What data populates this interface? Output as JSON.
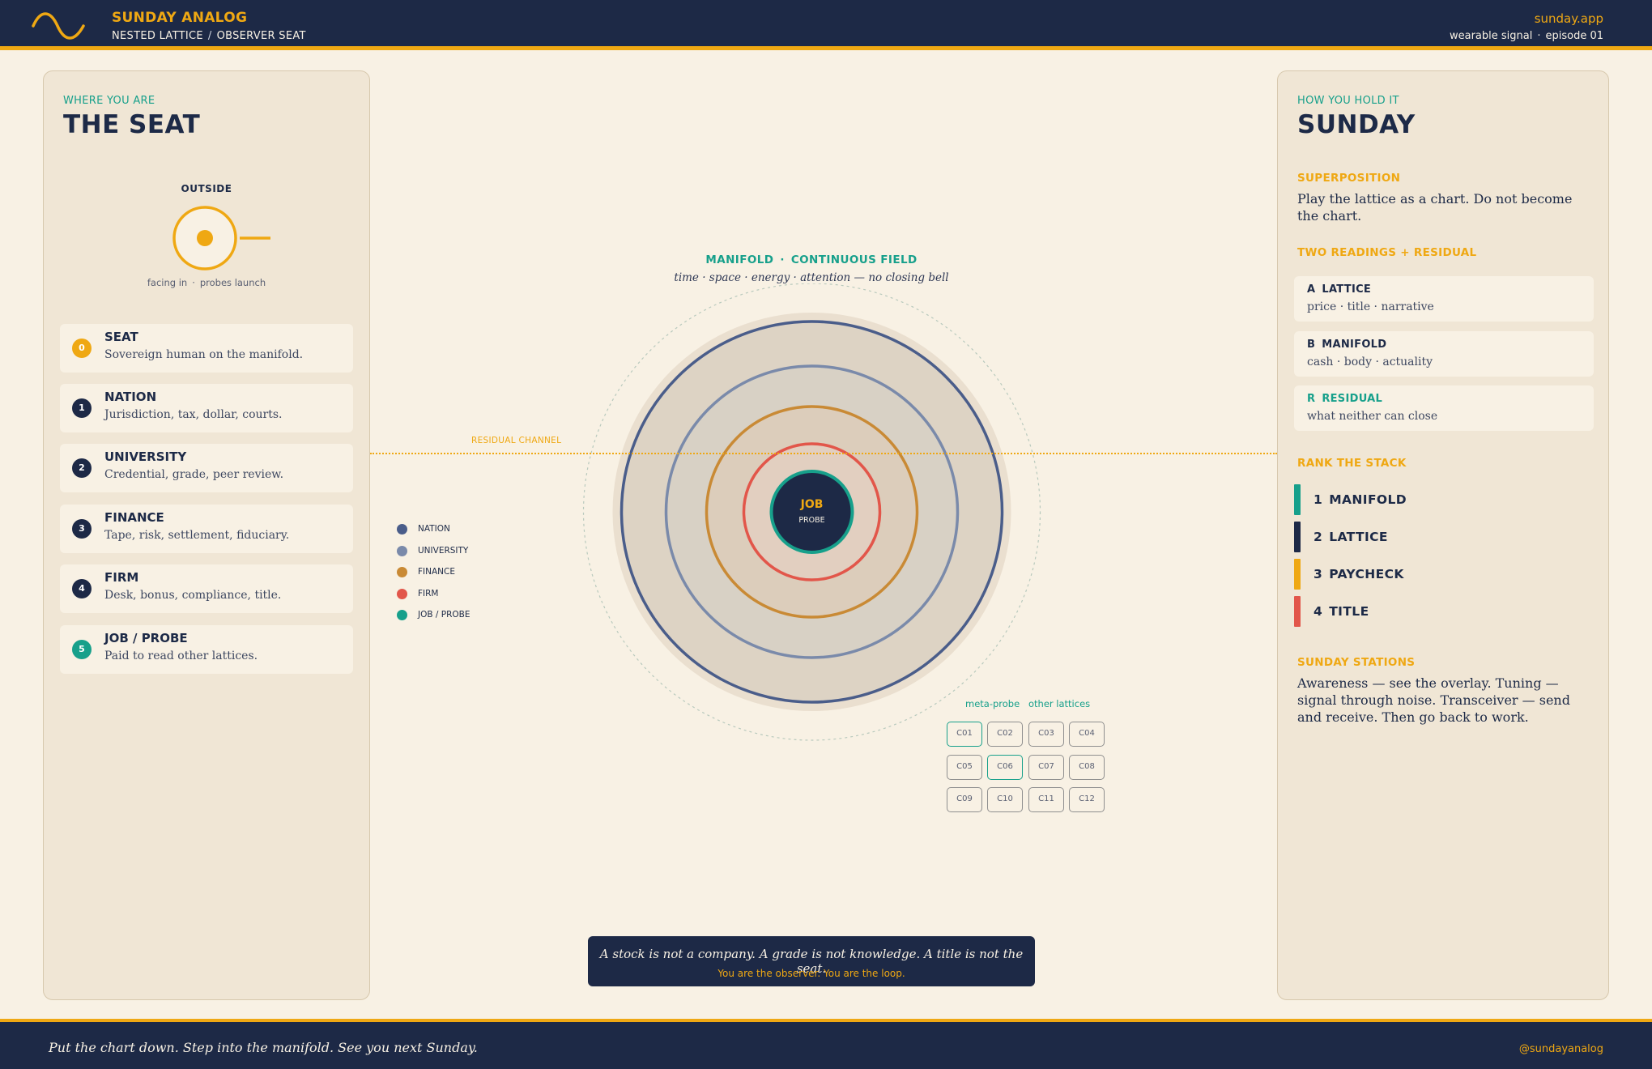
{
  "header": {
    "brand": "SUNDAY ANALOG",
    "crumb_1": "NESTED LATTICE",
    "crumb_sep": "/",
    "crumb_2": "OBSERVER SEAT",
    "site": "sunday.app",
    "meta_1": "wearable signal",
    "meta_dot": "·",
    "meta_2": "episode 01"
  },
  "left_panel": {
    "eyebrow": "WHERE YOU ARE",
    "title": "THE SEAT",
    "outside_label": "OUTSIDE",
    "caption_1": "facing in",
    "caption_dot": "·",
    "caption_2": "probes launch",
    "layers": [
      {
        "num": "0",
        "name": "SEAT",
        "desc": "Sovereign human on the manifold.",
        "color": "#efa813"
      },
      {
        "num": "1",
        "name": "NATION",
        "desc": "Jurisdiction, tax, dollar, courts.",
        "color": "#1d2946"
      },
      {
        "num": "2",
        "name": "UNIVERSITY",
        "desc": "Credential, grade, peer review.",
        "color": "#1d2946"
      },
      {
        "num": "3",
        "name": "FINANCE",
        "desc": "Tape, risk, settlement, fiduciary.",
        "color": "#1d2946"
      },
      {
        "num": "4",
        "name": "FIRM",
        "desc": "Desk, bonus, compliance, title.",
        "color": "#1d2946"
      },
      {
        "num": "5",
        "name": "JOB / PROBE",
        "desc": "Paid to read other lattices.",
        "color": "#17a08b"
      }
    ]
  },
  "center": {
    "manifold_a": "MANIFOLD",
    "manifold_dot": "·",
    "manifold_b": "CONTINUOUS FIELD",
    "manifold_sub": "time · space · energy · attention  —  no closing bell",
    "residual_label": "RESIDUAL CHANNEL",
    "core_title": "JOB",
    "core_sub": "PROBE",
    "legend": [
      {
        "label": "NATION",
        "color": "#4a5d8a"
      },
      {
        "label": "UNIVERSITY",
        "color": "#7a8aaa"
      },
      {
        "label": "FINANCE",
        "color": "#c98a35"
      },
      {
        "label": "FIRM",
        "color": "#e2564a"
      },
      {
        "label": "JOB / PROBE",
        "color": "#17a08b"
      }
    ],
    "cells_header_1": "meta-probe",
    "cells_header_2": "other lattices",
    "cells": [
      "C01",
      "C02",
      "C03",
      "C04",
      "C05",
      "C06",
      "C07",
      "C08",
      "C09",
      "C10",
      "C11",
      "C12"
    ],
    "highlighted_cells": [
      "C01",
      "C06"
    ],
    "quote_main": "A stock is not a company.  A grade is not knowledge.  A title is not the seat.",
    "quote_sub": "You are the observer. You are the loop."
  },
  "right_panel": {
    "eyebrow": "HOW YOU HOLD IT",
    "title": "SUNDAY",
    "sec_superposition": "SUPERPOSITION",
    "superposition_text": "Play the lattice as a chart. Do not become the chart.",
    "sec_readings": "TWO READINGS + RESIDUAL",
    "readings": [
      {
        "letter": "A",
        "name": "LATTICE",
        "desc": "price · title · narrative",
        "color": "#1d2a47"
      },
      {
        "letter": "B",
        "name": "MANIFOLD",
        "desc": "cash · body · actuality",
        "color": "#1d2a47"
      },
      {
        "letter": "R",
        "name": "RESIDUAL",
        "desc": "what neither can close",
        "color": "#17a08b"
      }
    ],
    "sec_rank": "RANK THE STACK",
    "ranks": [
      {
        "n": "1",
        "label": "MANIFOLD",
        "color": "#17a08b"
      },
      {
        "n": "2",
        "label": "LATTICE",
        "color": "#1d2946"
      },
      {
        "n": "3",
        "label": "PAYCHECK",
        "color": "#efa813"
      },
      {
        "n": "4",
        "label": "TITLE",
        "color": "#e2564a"
      }
    ],
    "sec_stations": "SUNDAY STATIONS",
    "stations_text": "Awareness — see the overlay. Tuning — signal through noise. Transceiver — send and receive. Then go back to work."
  },
  "footer": {
    "quote": "Put the chart down. Step into the manifold.  See you next Sunday.",
    "handle": "@sundayanalog"
  },
  "colors": {
    "navy": "#1d2946",
    "amber": "#efa813",
    "teal": "#17a08b",
    "red": "#e2564a",
    "cream": "#f8f1e4"
  }
}
